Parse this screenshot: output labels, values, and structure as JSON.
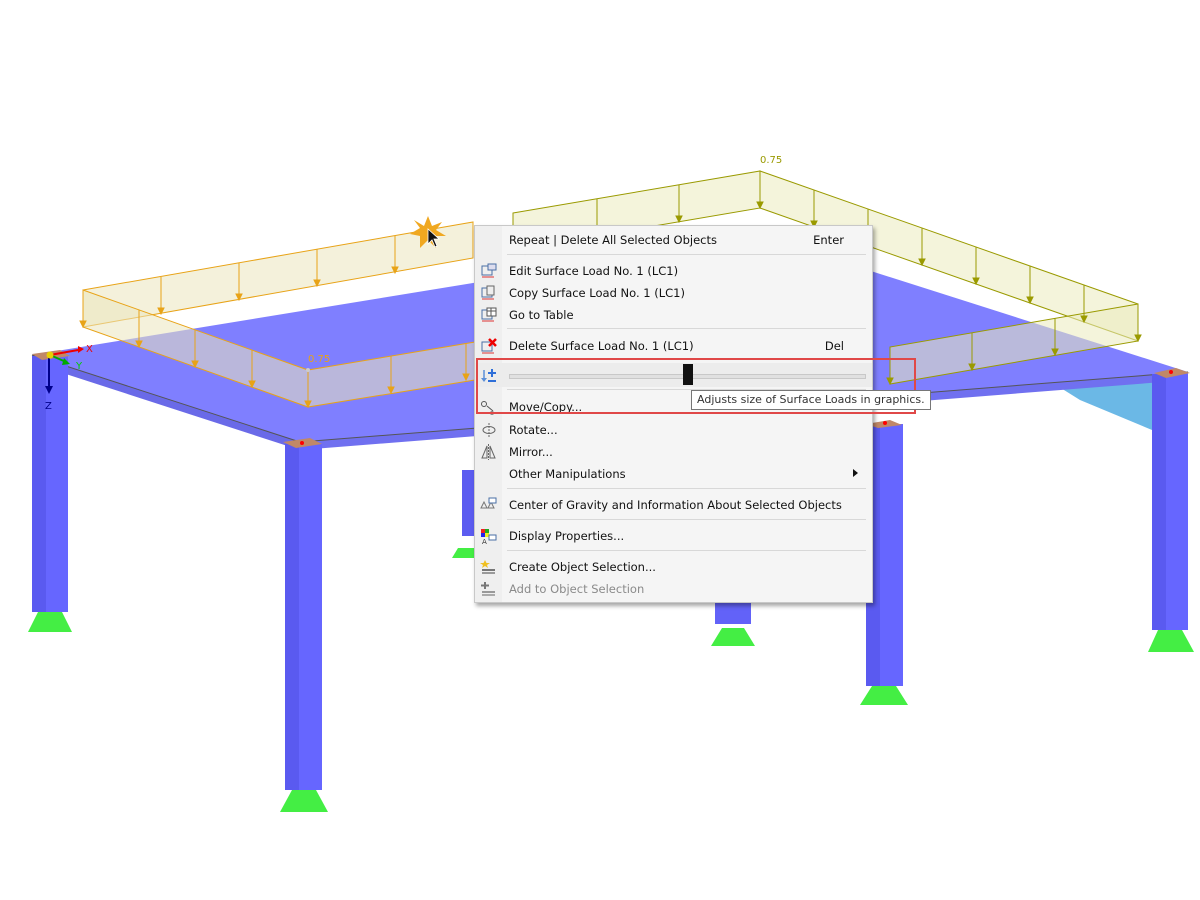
{
  "scene": {
    "load_value_left": "0.75",
    "load_value_right": "0.75",
    "axes": {
      "x": "X",
      "y": "Y",
      "z": "Z"
    },
    "colors": {
      "slab": "#7f7fff",
      "column": "#6666ff",
      "support": "#44ee44",
      "load_left": "#e8a317",
      "load_right": "#9a9a00",
      "highlight": "#e04848"
    }
  },
  "context_menu": {
    "items": [
      {
        "label": "Repeat | Delete All Selected Objects",
        "shortcut": "Enter",
        "icon": ""
      },
      {
        "label": "Edit Surface Load No. 1 (LC1)",
        "icon": "edit-load-icon"
      },
      {
        "label": "Copy Surface Load No. 1 (LC1)",
        "icon": "copy-load-icon"
      },
      {
        "label": "Go to Table",
        "icon": "table-icon"
      },
      {
        "label": "Delete Surface Load No. 1 (LC1)",
        "shortcut": "Del",
        "icon": "delete-load-icon"
      },
      {
        "label": "Move/Copy...",
        "icon": "move-copy-icon"
      },
      {
        "label": "Rotate...",
        "icon": "rotate-icon"
      },
      {
        "label": "Mirror...",
        "icon": "mirror-icon"
      },
      {
        "label": "Other Manipulations",
        "icon": "",
        "submenu": true
      },
      {
        "label": "Center of Gravity and Information About Selected Objects",
        "icon": "center-of-gravity-icon"
      },
      {
        "label": "Display Properties...",
        "icon": "display-properties-icon"
      },
      {
        "label": "Create Object Selection...",
        "icon": "create-selection-icon"
      },
      {
        "label": "Add to Object Selection",
        "icon": "add-selection-icon",
        "disabled": true
      }
    ],
    "load_size_slider": {
      "icon": "load-size-icon",
      "value_percent": 50
    },
    "tooltip": "Adjusts size of Surface Loads in graphics."
  }
}
